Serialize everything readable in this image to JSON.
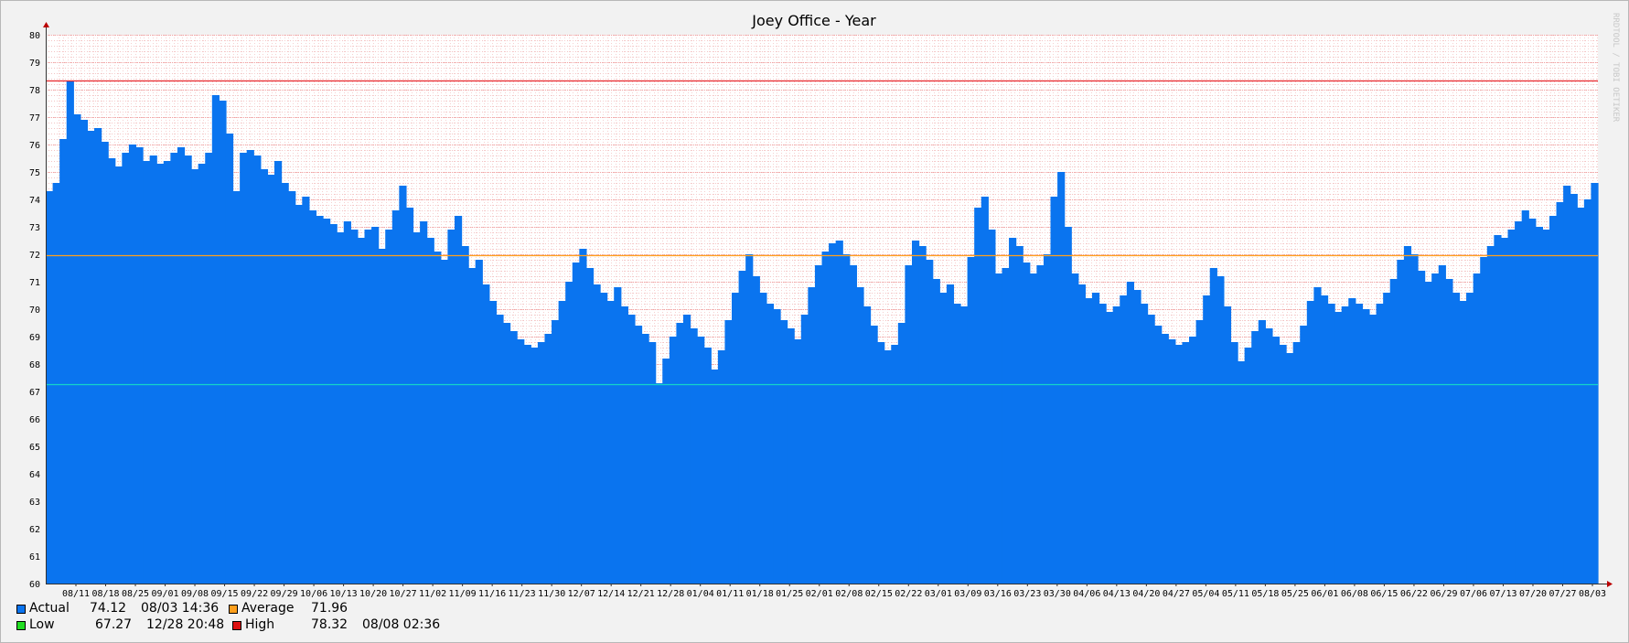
{
  "chart_data": {
    "type": "area",
    "title": "Joey Office - Year",
    "watermark": "RRDTOOL / TOBI OETIKER",
    "ylim": [
      60,
      80
    ],
    "yticks": [
      60,
      61,
      62,
      63,
      64,
      65,
      66,
      67,
      68,
      69,
      70,
      71,
      72,
      73,
      74,
      75,
      76,
      77,
      78,
      79,
      80
    ],
    "x_tick_labels": [
      "08/11",
      "08/18",
      "08/25",
      "09/01",
      "09/08",
      "09/15",
      "09/22",
      "09/29",
      "10/06",
      "10/13",
      "10/20",
      "10/27",
      "11/02",
      "11/09",
      "11/16",
      "11/23",
      "11/30",
      "12/07",
      "12/14",
      "12/21",
      "12/28",
      "01/04",
      "01/11",
      "01/18",
      "01/25",
      "02/01",
      "02/08",
      "02/15",
      "02/22",
      "03/01",
      "03/09",
      "03/16",
      "03/23",
      "03/30",
      "04/06",
      "04/13",
      "04/20",
      "04/27",
      "05/04",
      "05/11",
      "05/18",
      "05/25",
      "06/01",
      "06/08",
      "06/15",
      "06/22",
      "06/29",
      "07/06",
      "07/13",
      "07/20",
      "07/27",
      "08/03"
    ],
    "grid": true,
    "series": [
      {
        "name": "Actual",
        "color": "#0a74ef",
        "x_start": "08/03",
        "x_end": "08/03",
        "values": [
          74.3,
          74.6,
          76.2,
          78.3,
          77.1,
          76.9,
          76.5,
          76.6,
          76.1,
          75.5,
          75.2,
          75.7,
          76.0,
          75.9,
          75.4,
          75.6,
          75.3,
          75.4,
          75.7,
          75.9,
          75.6,
          75.1,
          75.3,
          75.7,
          77.8,
          77.6,
          76.4,
          74.3,
          75.7,
          75.8,
          75.6,
          75.1,
          74.9,
          75.4,
          74.6,
          74.3,
          73.8,
          74.1,
          73.6,
          73.4,
          73.3,
          73.1,
          72.8,
          73.2,
          72.9,
          72.6,
          72.9,
          73.0,
          72.2,
          72.9,
          73.6,
          74.5,
          73.7,
          72.8,
          73.2,
          72.6,
          72.1,
          71.8,
          72.9,
          73.4,
          72.3,
          71.5,
          71.8,
          70.9,
          70.3,
          69.8,
          69.5,
          69.2,
          68.9,
          68.7,
          68.6,
          68.8,
          69.1,
          69.6,
          70.3,
          71.0,
          71.7,
          72.2,
          71.5,
          70.9,
          70.6,
          70.3,
          70.8,
          70.1,
          69.8,
          69.4,
          69.1,
          68.8,
          67.3,
          68.2,
          69.0,
          69.5,
          69.8,
          69.3,
          69.0,
          68.6,
          67.8,
          68.5,
          69.6,
          70.6,
          71.4,
          72.0,
          71.2,
          70.6,
          70.2,
          70.0,
          69.6,
          69.3,
          68.9,
          69.8,
          70.8,
          71.6,
          72.1,
          72.4,
          72.5,
          72.0,
          71.6,
          70.8,
          70.1,
          69.4,
          68.8,
          68.5,
          68.7,
          69.5,
          71.6,
          72.5,
          72.3,
          71.8,
          71.1,
          70.6,
          70.9,
          70.2,
          70.1,
          71.9,
          73.7,
          74.1,
          72.9,
          71.3,
          71.5,
          72.6,
          72.3,
          71.7,
          71.3,
          71.6,
          72.0,
          74.1,
          75.0,
          73.0,
          71.3,
          70.9,
          70.4,
          70.6,
          70.2,
          69.9,
          70.1,
          70.5,
          71.0,
          70.7,
          70.2,
          69.8,
          69.4,
          69.1,
          68.9,
          68.7,
          68.8,
          69.0,
          69.6,
          70.5,
          71.5,
          71.2,
          70.1,
          68.8,
          68.1,
          68.6,
          69.2,
          69.6,
          69.3,
          69.0,
          68.7,
          68.4,
          68.8,
          69.4,
          70.3,
          70.8,
          70.5,
          70.2,
          69.9,
          70.1,
          70.4,
          70.2,
          70.0,
          69.8,
          70.2,
          70.6,
          71.1,
          71.8,
          72.3,
          72.0,
          71.4,
          71.0,
          71.3,
          71.6,
          71.1,
          70.6,
          70.3,
          70.6,
          71.3,
          71.9,
          72.3,
          72.7,
          72.6,
          72.9,
          73.2,
          73.6,
          73.3,
          73.0,
          72.9,
          73.4,
          73.9,
          74.5,
          74.2,
          73.7,
          74.0,
          74.6
        ]
      }
    ],
    "reference_lines": [
      {
        "name": "Average",
        "value": 71.96,
        "color": "#ff9f1c"
      },
      {
        "name": "Low",
        "value": 67.27,
        "color": "#14d4c8"
      },
      {
        "name": "High",
        "value": 78.32,
        "color": "#e8262b"
      }
    ]
  },
  "legend": {
    "actual": {
      "label": "Actual",
      "value": "74.12",
      "time": "08/03 14:36",
      "color": "#0a74ef"
    },
    "average": {
      "label": "Average",
      "value": "71.96",
      "color": "#ff9f1c"
    },
    "low": {
      "label": "Low",
      "value": "67.27",
      "time": "12/28 20:48",
      "color": "#22dd22"
    },
    "high": {
      "label": "High",
      "value": "78.32",
      "time": "08/08 02:36",
      "color": "#dd1111"
    }
  }
}
